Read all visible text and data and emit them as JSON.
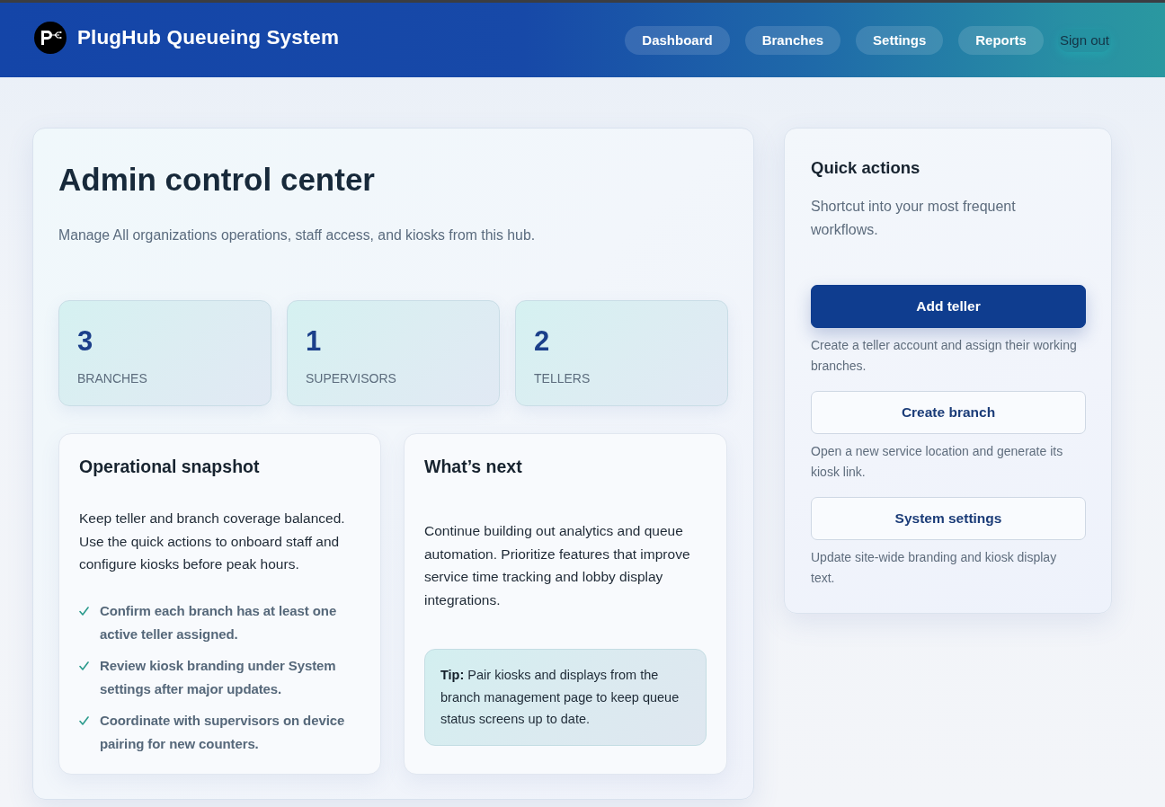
{
  "header": {
    "title": "PlugHub Queueing System",
    "nav": [
      {
        "label": "Dashboard",
        "kind": "pill"
      },
      {
        "label": "Branches",
        "kind": "pill"
      },
      {
        "label": "Settings",
        "kind": "pill"
      },
      {
        "label": "Reports",
        "kind": "pill"
      },
      {
        "label": "Sign out",
        "kind": "plain"
      }
    ]
  },
  "overview": {
    "title": "Admin control center",
    "subtitle": "Manage All organizations operations, staff access, and kiosks from this hub.",
    "stats": [
      {
        "value": "3",
        "label": "BRANCHES"
      },
      {
        "value": "1",
        "label": "SUPERVISORS"
      },
      {
        "value": "2",
        "label": "TELLERS"
      }
    ],
    "snapshot": {
      "title": "Operational snapshot",
      "text": "Keep teller and branch coverage balanced. Use the quick actions to onboard staff and configure kiosks before peak hours.",
      "checklist": [
        "Confirm each branch has at least one active teller assigned.",
        "Review kiosk branding under System settings after major updates.",
        "Coordinate with supervisors on device pairing for new counters."
      ]
    },
    "next": {
      "title": "What’s next",
      "text": "Continue building out analytics and queue automation. Prioritize features that improve service time tracking and lobby display integrations.",
      "tip": "**Tip:** Pair kiosks and displays from the branch management page to keep queue status screens up to date."
    }
  },
  "quick_actions": {
    "title": "Quick actions",
    "description": "Shortcut into your most frequent workflows.",
    "actions": [
      {
        "label": "Add teller",
        "kind": "primary",
        "description": "Create a teller account and assign their working branches."
      },
      {
        "label": "Create branch",
        "kind": "secondary",
        "description": "Open a new service location and generate its kiosk link."
      },
      {
        "label": "System settings",
        "kind": "secondary",
        "description": "Update site-wide branding and kiosk display text."
      }
    ]
  }
}
